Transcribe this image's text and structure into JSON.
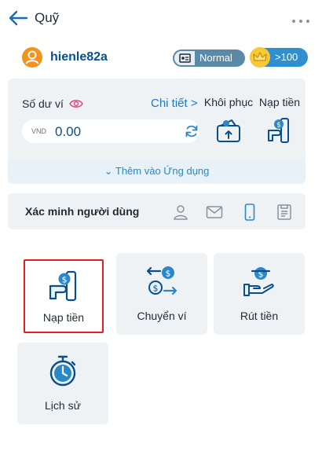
{
  "header": {
    "title": "Quỹ"
  },
  "user": {
    "username": "hienle82a",
    "level_badge": "Normal",
    "vip_badge": ">100"
  },
  "wallet": {
    "balance_label": "Số dư ví",
    "detail_link": "Chi tiết >",
    "currency": "VND",
    "amount": "0.00",
    "actions": {
      "restore": "Khôi phục",
      "deposit": "Nạp tiền"
    },
    "add_to_app": "⌄ Thêm vào Ứng dụng"
  },
  "verify": {
    "label": "Xác minh người dùng"
  },
  "tiles": {
    "deposit": "Nạp tiền",
    "transfer": "Chuyển ví",
    "withdraw": "Rút tiền",
    "history": "Lịch sử"
  },
  "colors": {
    "brand_dark": "#0a4f8a",
    "accent_blue": "#1a7bc9",
    "card_bg": "#eef2f5",
    "selected_border": "#e02020",
    "avatar": "#f5921e"
  }
}
